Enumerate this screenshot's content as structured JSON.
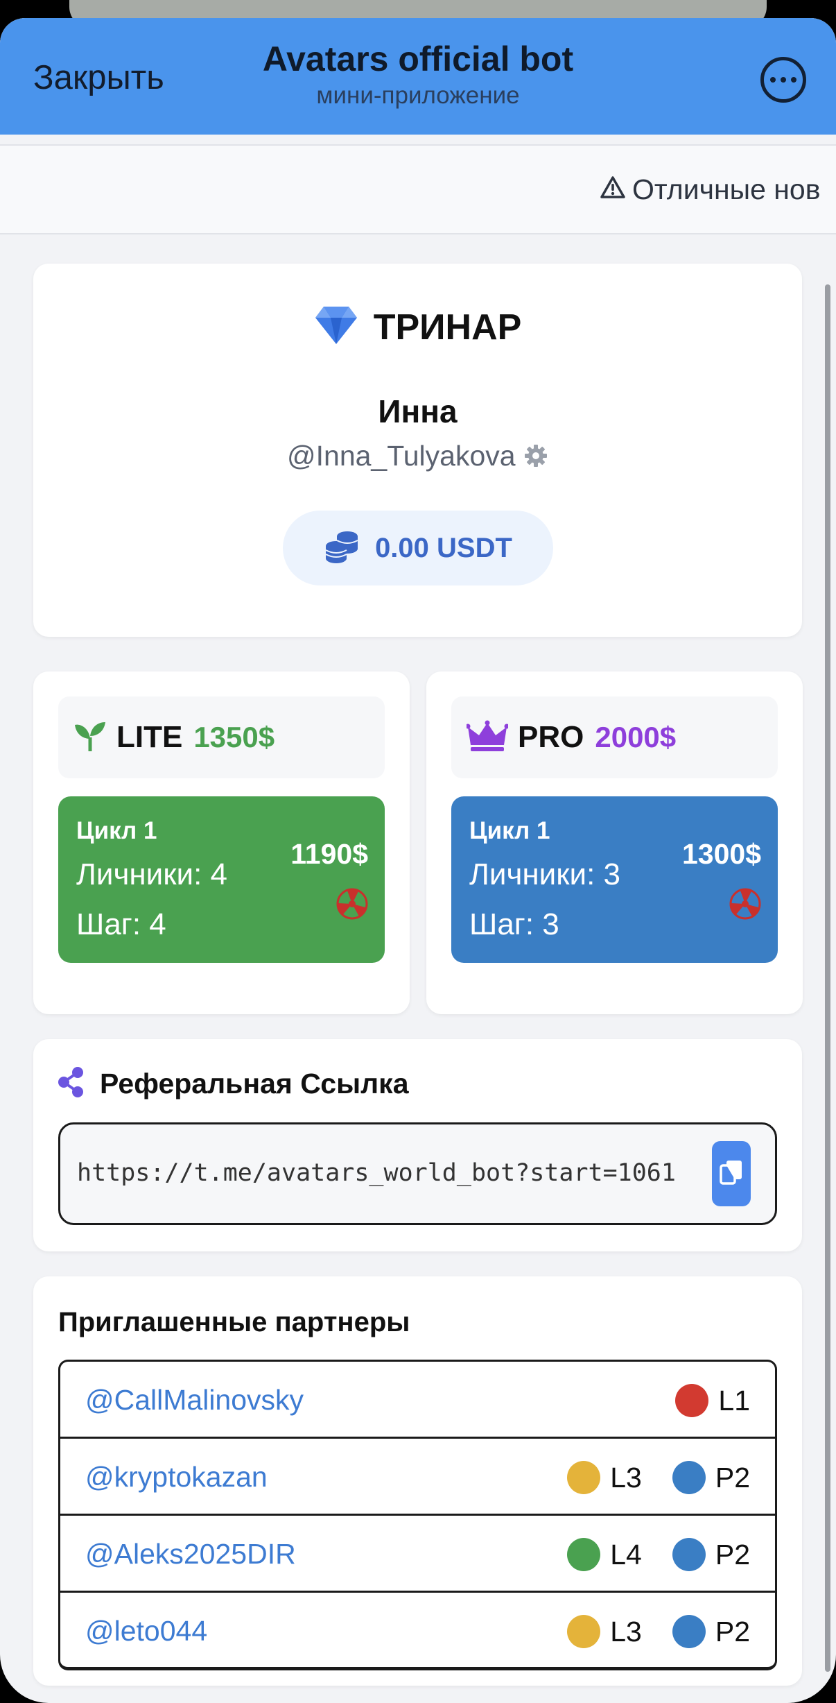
{
  "header": {
    "close_label": "Закрыть",
    "title": "Avatars official bot",
    "subtitle": "мини-приложение",
    "more_icon": "more-horizontal-icon"
  },
  "ticker": {
    "text": "Отличные нов"
  },
  "profile": {
    "brand": "ТРИНАР",
    "brand_icon": "diamond-icon",
    "name": "Инна",
    "handle": "@Inna_Tulyakova",
    "balance": "0.00 USDT",
    "balance_icon": "coins-icon",
    "accent": "#3b67c6"
  },
  "plans": {
    "lite": {
      "name": "LITE",
      "price": "1350$",
      "price_color": "#4aa150",
      "cycle_color": "#4aa150",
      "cycle_title": "Цикл 1",
      "personal": "Личники: 4",
      "step": "Шаг: 4",
      "amount": "1190$"
    },
    "pro": {
      "name": "PRO",
      "price": "2000$",
      "price_color": "#8e3fdb",
      "cycle_color": "#3a7ec4",
      "cycle_title": "Цикл 1",
      "personal": "Личники: 3",
      "step": "Шаг: 3",
      "amount": "1300$"
    }
  },
  "referral": {
    "title": "Реферальная Ссылка",
    "link": "https://t.me/avatars_world_bot?start=1061",
    "share_icon": "share-icon",
    "copy_icon": "copy-icon"
  },
  "partners": {
    "title": "Приглашенные партнеры",
    "rows": [
      {
        "handle": "@CallMalinovsky",
        "badges": [
          {
            "label": "L1",
            "color": "#d23a30"
          }
        ]
      },
      {
        "handle": "@kryptokazan",
        "badges": [
          {
            "label": "L3",
            "color": "#e4b33a"
          },
          {
            "label": "P2",
            "color": "#3a7ec4"
          }
        ]
      },
      {
        "handle": "@Aleks2025DIR",
        "badges": [
          {
            "label": "L4",
            "color": "#4aa150"
          },
          {
            "label": "P2",
            "color": "#3a7ec4"
          }
        ]
      },
      {
        "handle": "@leto044",
        "badges": [
          {
            "label": "L3",
            "color": "#e4b33a"
          },
          {
            "label": "P2",
            "color": "#3a7ec4"
          }
        ]
      }
    ]
  }
}
